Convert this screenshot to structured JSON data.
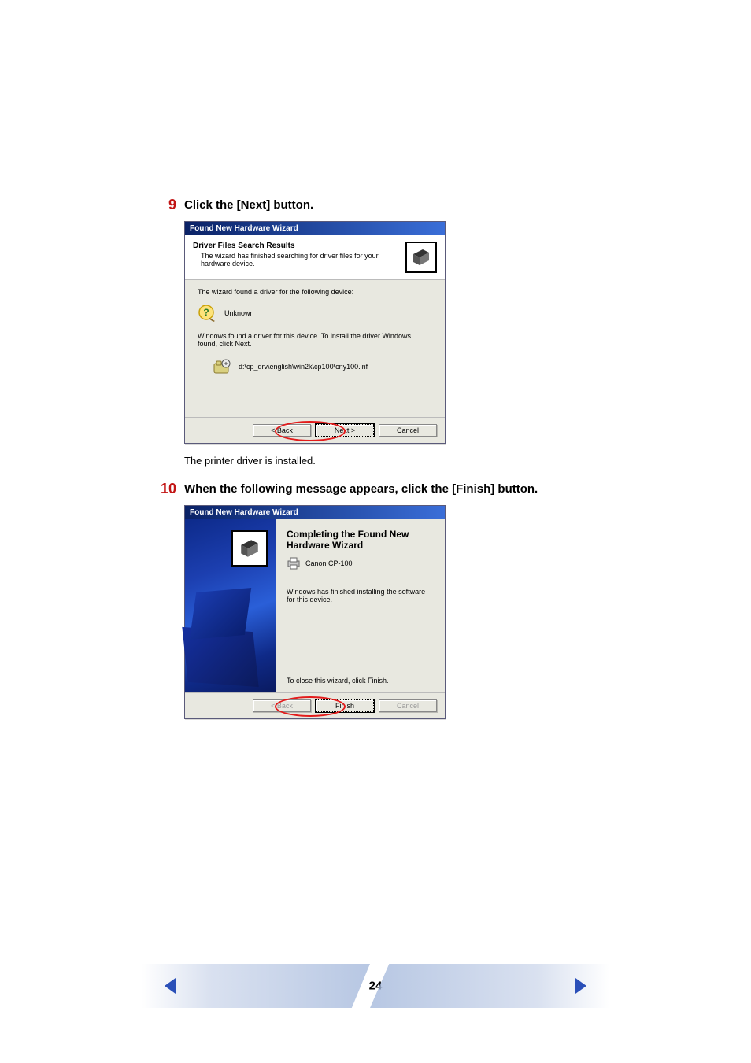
{
  "steps": {
    "s9": {
      "num": "9",
      "title": "Click the [Next] button.",
      "result": "The printer driver is installed."
    },
    "s10": {
      "num": "10",
      "title": "When the following message appears, click the [Finish] button."
    }
  },
  "wizard1": {
    "titlebar": "Found New Hardware Wizard",
    "header_title": "Driver Files Search Results",
    "header_sub": "The wizard has finished searching for driver files for your hardware device.",
    "body_found": "The wizard found a driver for the following device:",
    "device_name": "Unknown",
    "found_driver": "Windows found a driver for this device. To install the driver Windows found, click Next.",
    "inf_path": "d:\\cp_drv\\english\\win2k\\cp100\\cny100.inf",
    "buttons": {
      "back": "< Back",
      "next": "Next >",
      "cancel": "Cancel"
    }
  },
  "wizard2": {
    "titlebar": "Found New Hardware Wizard",
    "title": "Completing the Found New Hardware Wizard",
    "device": "Canon CP-100",
    "msg": "Windows has finished installing the software for this device.",
    "close_hint": "To close this wizard, click Finish.",
    "buttons": {
      "back": "< Back",
      "finish": "Finish",
      "cancel": "Cancel"
    }
  },
  "page": {
    "number": "24"
  }
}
